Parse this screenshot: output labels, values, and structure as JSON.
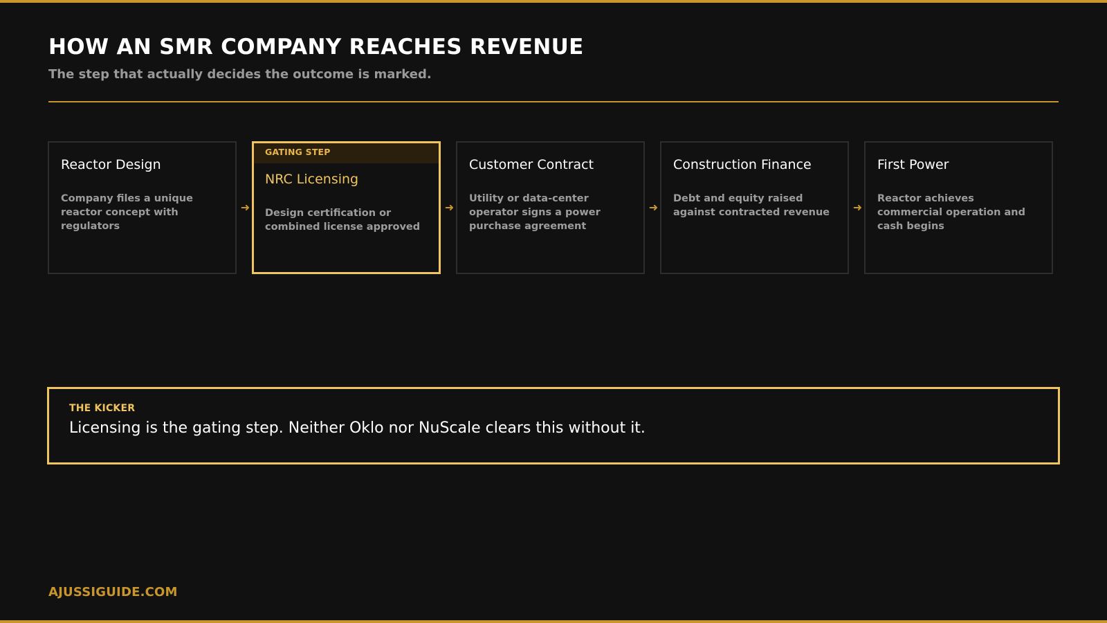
{
  "header": {
    "title": "HOW AN SMR COMPANY REACHES REVENUE",
    "subtitle": "The step that actually decides the outcome is marked."
  },
  "flow": {
    "steps": [
      {
        "title": "Reactor Design",
        "description": "Company files a unique reactor concept with regulators"
      },
      {
        "tag": "GATING STEP",
        "title": "NRC Licensing",
        "description": "Design certification or combined license approved"
      },
      {
        "title": "Customer Contract",
        "description": "Utility or data-center operator signs a power purchase agreement"
      },
      {
        "title": "Construction Finance",
        "description": "Debt and equity raised against contracted revenue"
      },
      {
        "title": "First Power",
        "description": "Reactor achieves commercial operation and cash begins"
      }
    ]
  },
  "kicker": {
    "label": "THE KICKER",
    "text": "Licensing is the gating step. Neither Oklo nor NuScale clears this without it."
  },
  "footer": {
    "brand": "AJUSSIGUIDE.COM"
  },
  "colors": {
    "accent": "#c9962e",
    "highlight": "#f0c45e",
    "background": "#111111"
  }
}
